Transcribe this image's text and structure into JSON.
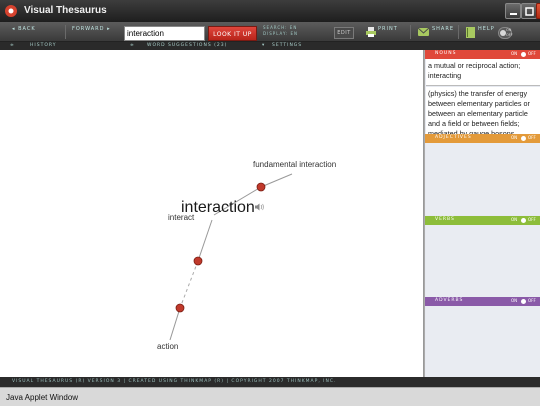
{
  "window": {
    "title": "Visual Thesaurus"
  },
  "toolbar": {
    "back_label": "◂ BACK",
    "forward_label": "FORWARD ▸",
    "search_value": "interaction",
    "lookup_label": "LOOK IT UP",
    "search_mode_label": "SEARCH: EN",
    "display_mode_label": "DISPLAY: EN",
    "edit_label": "EDIT",
    "print_label": "PRINT",
    "share_label": "SHARE",
    "help_label": "HELP",
    "toggle_on": "ON",
    "toggle_off": "OFF"
  },
  "subheader": {
    "history_label": "HISTORY",
    "suggestions_label": "WORD SUGGESTIONS (23)",
    "settings_label": "SETTINGS"
  },
  "graph": {
    "center_word": "interaction",
    "related_words": [
      "fundamental interaction",
      "interact",
      "action"
    ]
  },
  "panel": {
    "sections": [
      {
        "name": "NOUNS",
        "on": "ON",
        "off": "OFF",
        "color": "#e0483a"
      },
      {
        "name": "ADJECTIVES",
        "on": "ON",
        "off": "OFF",
        "color": "#e39a3a"
      },
      {
        "name": "VERBS",
        "on": "ON",
        "off": "OFF",
        "color": "#8dbd3a"
      },
      {
        "name": "ADVERBS",
        "on": "ON",
        "off": "OFF",
        "color": "#8a5aa8"
      }
    ],
    "definitions": [
      "a mutual or reciprocal action; interacting",
      "(physics) the transfer of energy between elementary particles or between an elementary particle and a field or between fields; mediated by gauge bosons"
    ]
  },
  "footer": {
    "credits": "VISUAL THESAURUS (R) VERSION 3 | CREATED USING THINKMAP (R) | COPYRIGHT 2007 THINKMAP, INC."
  },
  "status": {
    "text": "Java Applet Window"
  }
}
